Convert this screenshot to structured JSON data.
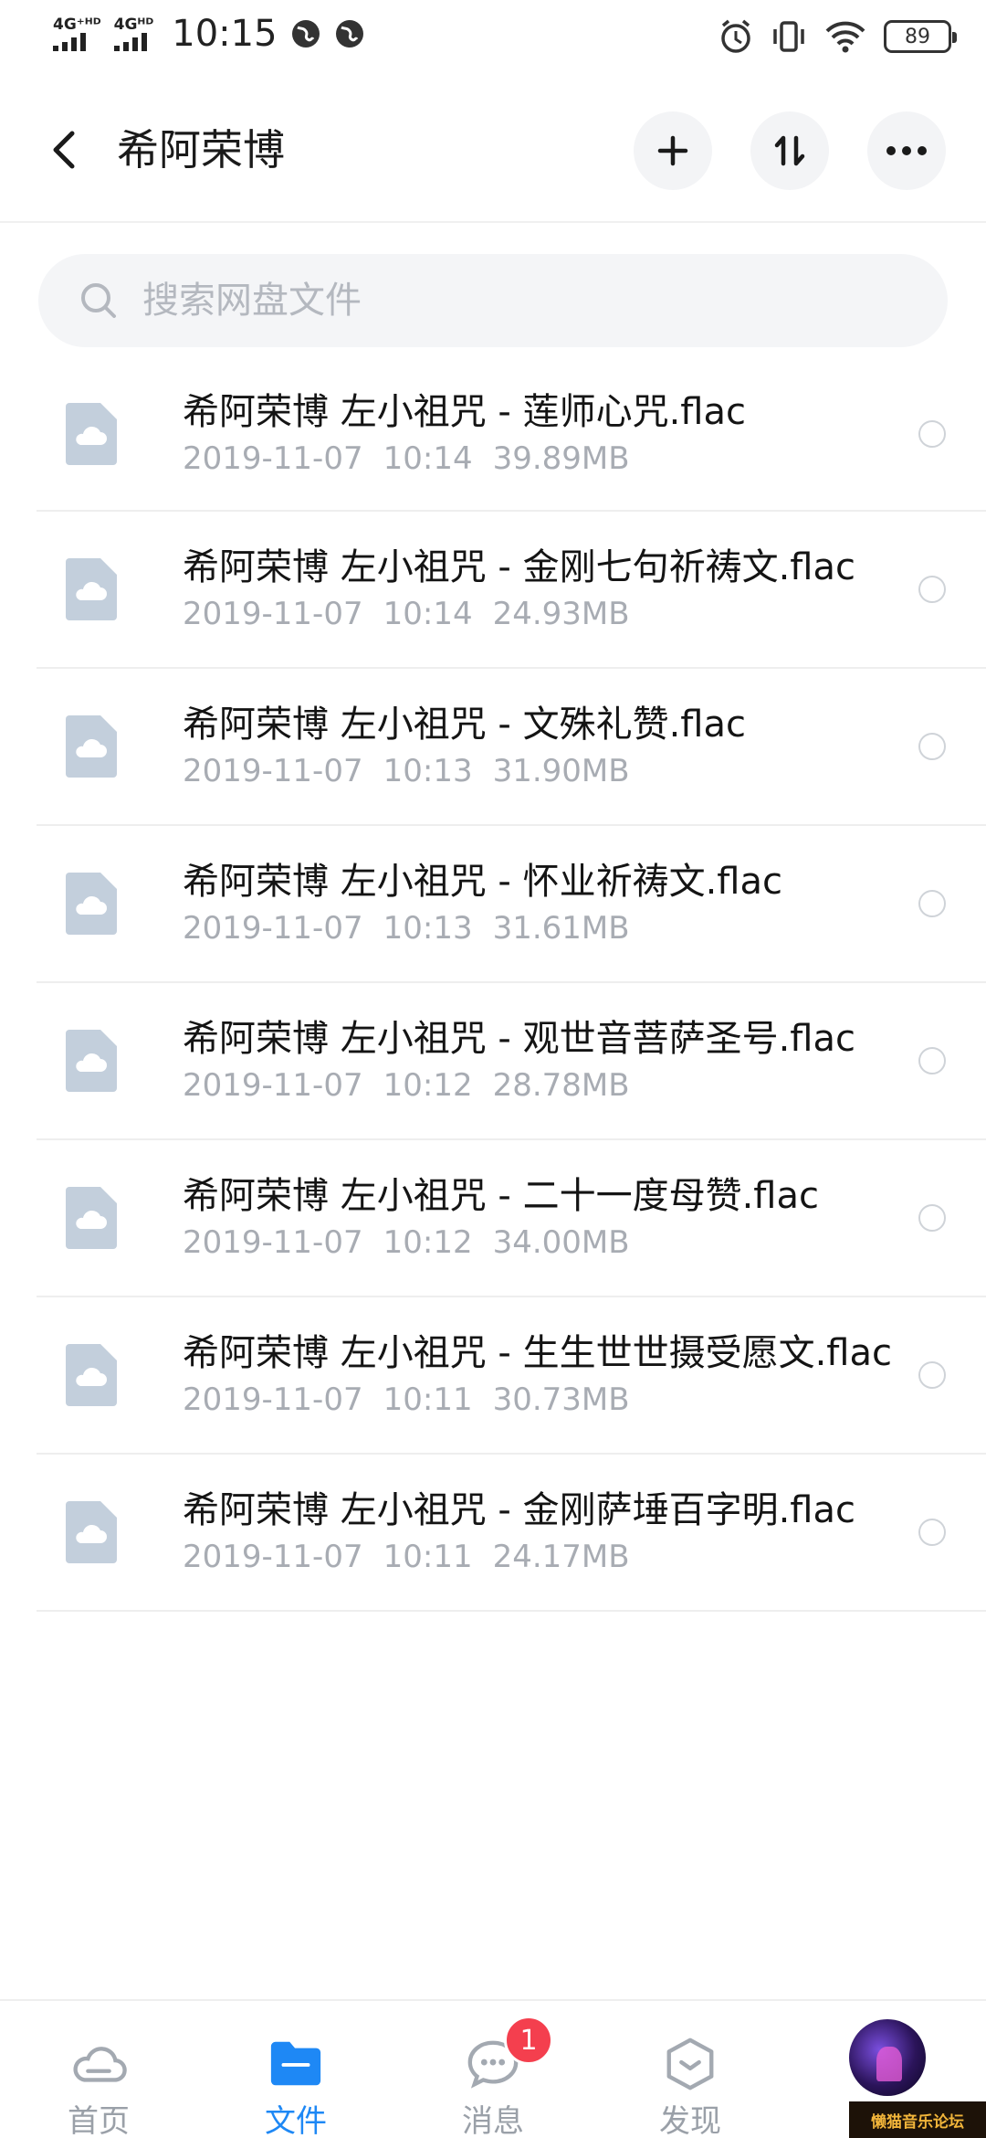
{
  "status_bar": {
    "signal1_label": "4G⁺ᴴᴰ",
    "signal2_label": "4Gᴴᴰ",
    "time": "10:15",
    "battery": "89",
    "icons": [
      "globe-icon",
      "globe-icon",
      "alarm-icon",
      "vibrate-icon",
      "wifi-icon",
      "battery-icon"
    ]
  },
  "header": {
    "title": "希阿荣博",
    "back_icon": "chevron-left-icon",
    "actions": [
      "plus-icon",
      "sort-icon",
      "more-icon"
    ]
  },
  "search": {
    "placeholder": "搜索网盘文件"
  },
  "files": [
    {
      "name": "希阿荣博 左小祖咒 - 莲师心咒.flac",
      "date": "2019-11-07",
      "time": "10:14",
      "size": "39.89MB"
    },
    {
      "name": "希阿荣博 左小祖咒 - 金刚七句祈祷文.flac",
      "date": "2019-11-07",
      "time": "10:14",
      "size": "24.93MB"
    },
    {
      "name": "希阿荣博 左小祖咒 - 文殊礼赞.flac",
      "date": "2019-11-07",
      "time": "10:13",
      "size": "31.90MB"
    },
    {
      "name": "希阿荣博 左小祖咒 - 怀业祈祷文.flac",
      "date": "2019-11-07",
      "time": "10:13",
      "size": "31.61MB"
    },
    {
      "name": "希阿荣博 左小祖咒 - 观世音菩萨圣号.flac",
      "date": "2019-11-07",
      "time": "10:12",
      "size": "28.78MB"
    },
    {
      "name": "希阿荣博 左小祖咒 - 二十一度母赞.flac",
      "date": "2019-11-07",
      "time": "10:12",
      "size": "34.00MB"
    },
    {
      "name": "希阿荣博 左小祖咒 - 生生世世摄受愿文.flac",
      "date": "2019-11-07",
      "time": "10:11",
      "size": "30.73MB"
    },
    {
      "name": "希阿荣博 左小祖咒 - 金刚萨埵百字明.flac",
      "date": "2019-11-07",
      "time": "10:11",
      "size": "24.17MB"
    }
  ],
  "bottom_nav": {
    "items": [
      {
        "label": "首页",
        "icon": "cloud-icon"
      },
      {
        "label": "文件",
        "icon": "folder-icon",
        "active": true
      },
      {
        "label": "消息",
        "icon": "chat-icon",
        "badge": "1"
      },
      {
        "label": "发现",
        "icon": "discover-icon"
      },
      {
        "label": "",
        "icon": "avatar"
      }
    ]
  },
  "watermark": "懒猫音乐论坛",
  "colors": {
    "accent": "#1e88f5",
    "badge": "#f43f4e",
    "file_icon": "#c3cfdc",
    "meta_text": "#a8acb3"
  }
}
